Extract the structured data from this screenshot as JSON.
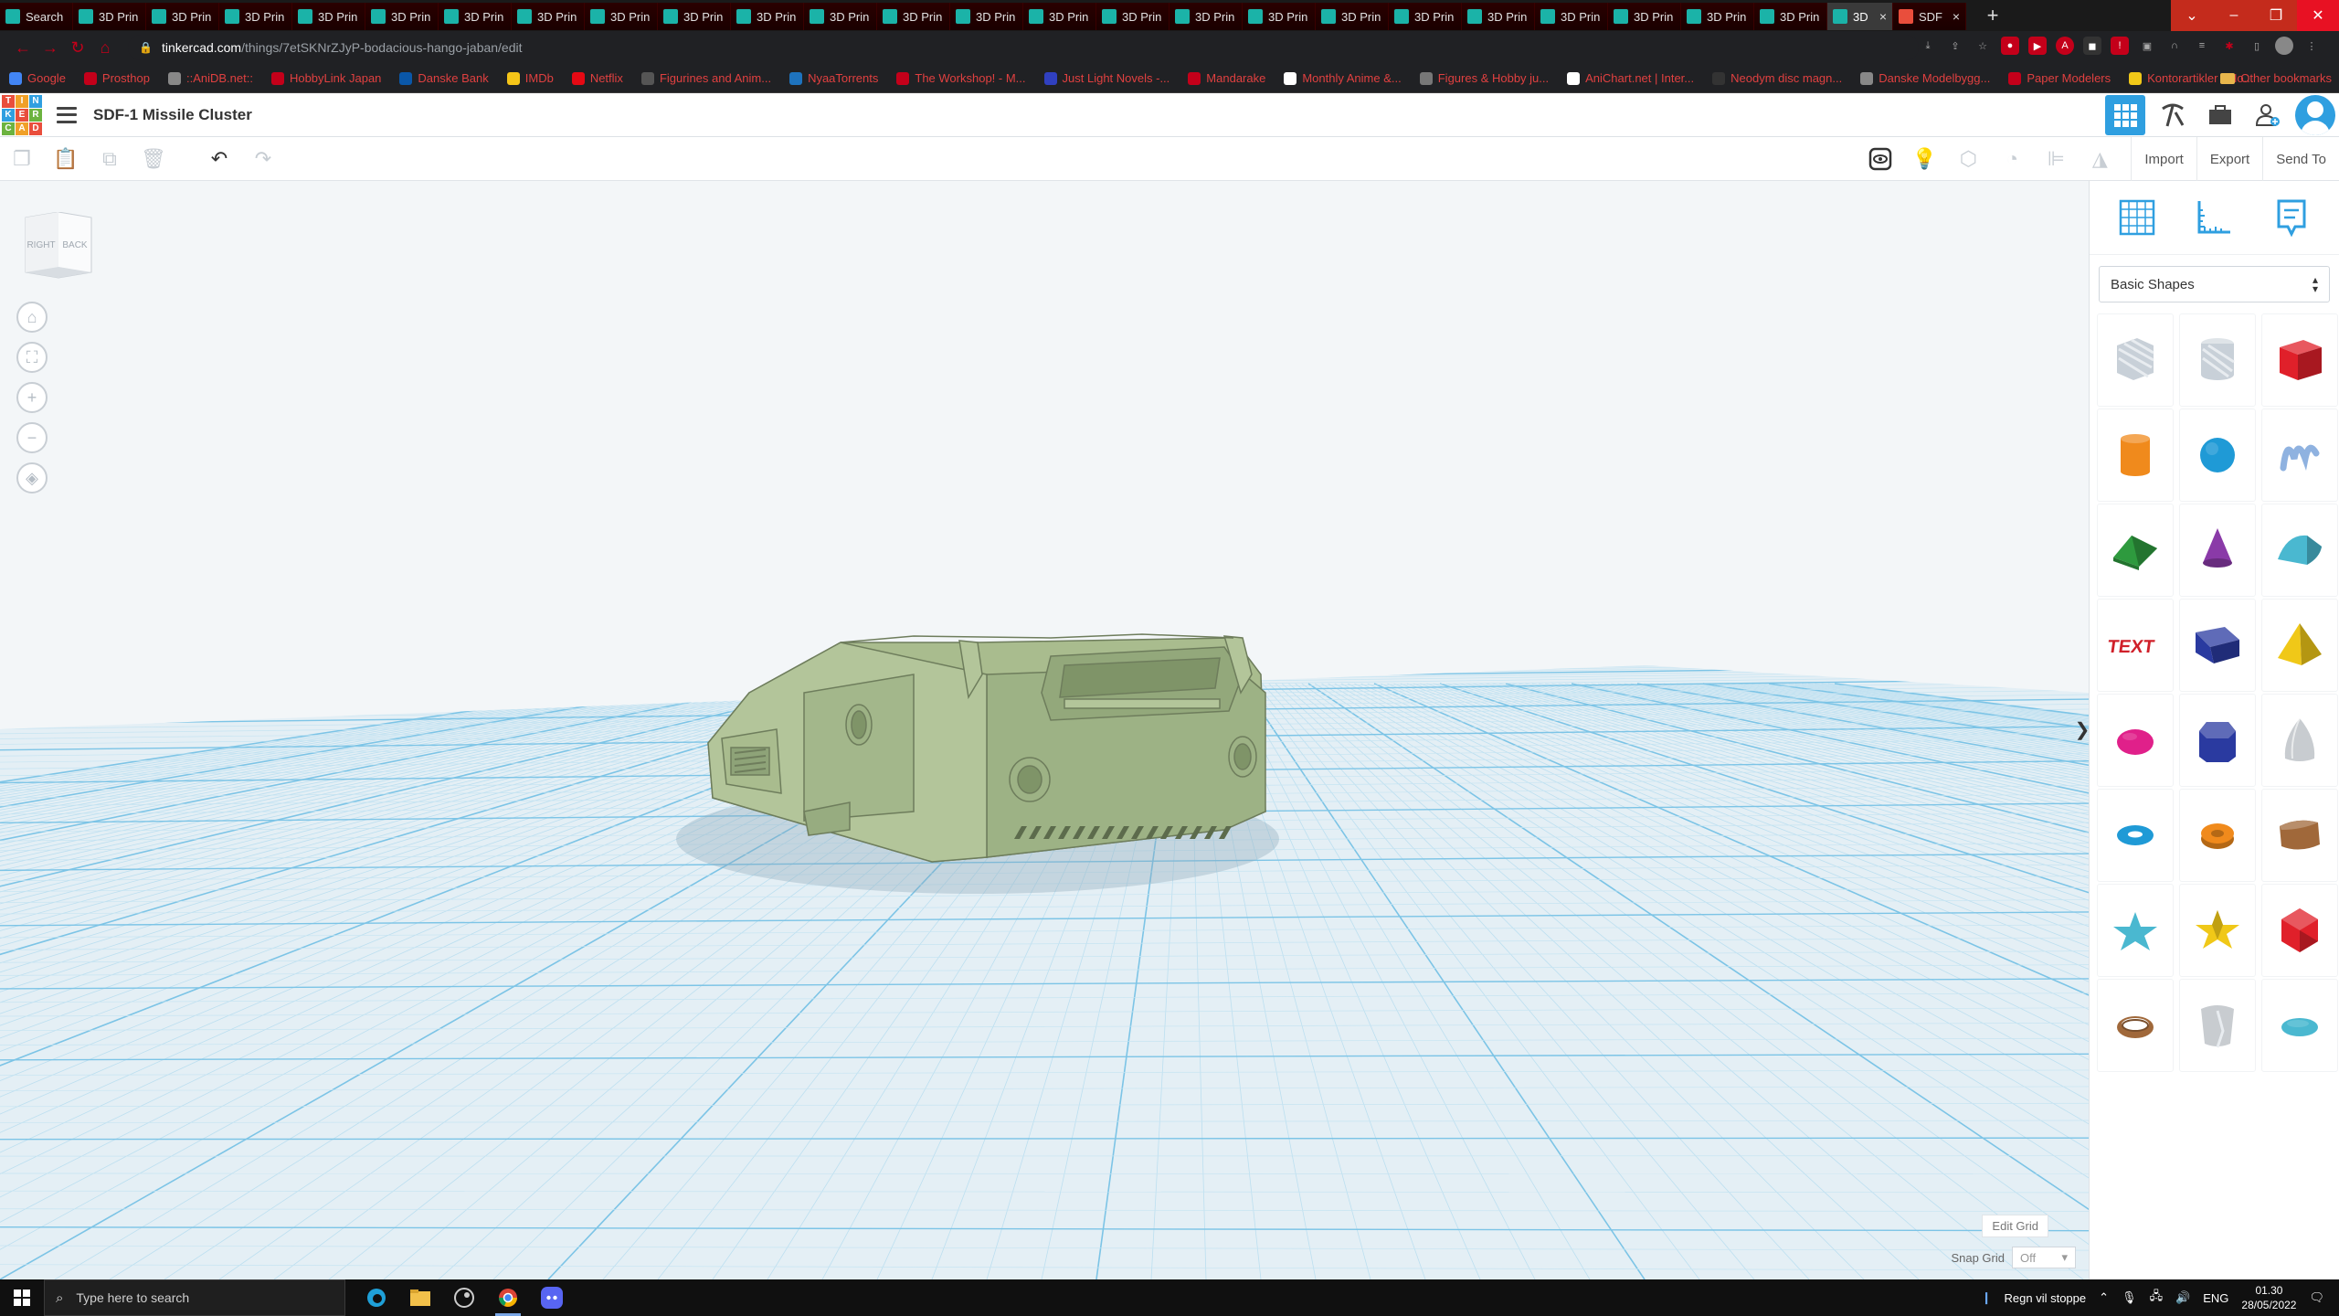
{
  "browser": {
    "tabs": [
      {
        "label": "Search",
        "icon": "tinkercad-icon"
      },
      {
        "label": "3D Prin",
        "icon": "tinkercad-icon"
      },
      {
        "label": "3D Prin",
        "icon": "tinkercad-icon"
      },
      {
        "label": "3D Prin",
        "icon": "tinkercad-icon"
      },
      {
        "label": "3D Prin",
        "icon": "tinkercad-icon"
      },
      {
        "label": "3D Prin",
        "icon": "tinkercad-icon"
      },
      {
        "label": "3D Prin",
        "icon": "tinkercad-icon"
      },
      {
        "label": "3D Prin",
        "icon": "tinkercad-icon"
      },
      {
        "label": "3D Prin",
        "icon": "tinkercad-icon"
      },
      {
        "label": "3D Prin",
        "icon": "tinkercad-icon"
      },
      {
        "label": "3D Prin",
        "icon": "tinkercad-icon"
      },
      {
        "label": "3D Prin",
        "icon": "tinkercad-icon"
      },
      {
        "label": "3D Prin",
        "icon": "tinkercad-icon"
      },
      {
        "label": "3D Prin",
        "icon": "tinkercad-icon"
      },
      {
        "label": "3D Prin",
        "icon": "tinkercad-icon"
      },
      {
        "label": "3D Prin",
        "icon": "tinkercad-icon"
      },
      {
        "label": "3D Prin",
        "icon": "tinkercad-icon"
      },
      {
        "label": "3D Prin",
        "icon": "tinkercad-icon"
      },
      {
        "label": "3D Prin",
        "icon": "tinkercad-icon"
      },
      {
        "label": "3D Prin",
        "icon": "tinkercad-icon"
      },
      {
        "label": "3D Prin",
        "icon": "tinkercad-icon"
      },
      {
        "label": "3D Prin",
        "icon": "tinkercad-icon"
      },
      {
        "label": "3D Prin",
        "icon": "tinkercad-icon"
      },
      {
        "label": "3D Prin",
        "icon": "tinkercad-icon"
      },
      {
        "label": "3D Prin",
        "icon": "tinkercad-icon"
      },
      {
        "label": "3D",
        "icon": "tinkercad-icon",
        "active": true
      },
      {
        "label": "SDF",
        "icon": "image-icon"
      }
    ],
    "new_tab": "+",
    "url_host": "tinkercad.com",
    "url_path": "/things/7etSKNrZJyP-bodacious-hango-jaban/edit",
    "bookmarks": [
      "Google",
      "Prosthop",
      "::AniDB.net::",
      "HobbyLink Japan",
      "Danske Bank",
      "IMDb",
      "Netflix",
      "Figurines and Anim...",
      "NyaaTorrents",
      "The Workshop! - M...",
      "Just Light Novels -...",
      "Mandarake",
      "Monthly Anime &...",
      "Figures & Hobby ju...",
      "AniChart.net | Inter...",
      "Neodym disc magn...",
      "Danske Modelbygg...",
      "Paper Modelers",
      "Kontorartikler - Ho..."
    ],
    "other_bookmarks": "Other bookmarks"
  },
  "tinkercad": {
    "logo_letters": [
      "T",
      "I",
      "N",
      "K",
      "E",
      "R",
      "C",
      "A",
      "D"
    ],
    "logo_colors": [
      "#e94e3c",
      "#f0a028",
      "#2f9fe0",
      "#2f9fe0",
      "#e94e3c",
      "#6cb33f",
      "#6cb33f",
      "#f0a028",
      "#e94e3c"
    ],
    "title": "SDF-1 Missile Cluster",
    "toolbar": {
      "import": "Import",
      "export": "Export",
      "send_to": "Send To"
    },
    "viewcube": {
      "right": "RIGHT",
      "back": "BACK"
    },
    "edit_grid": "Edit Grid",
    "snap_grid_label": "Snap Grid",
    "snap_grid_value": "Off",
    "panel": {
      "category": "Basic Shapes",
      "shapes": [
        {
          "name": "box-hole",
          "color": "#b9c2cc"
        },
        {
          "name": "cylinder-hole",
          "color": "#b9c2cc"
        },
        {
          "name": "box",
          "color": "#e0202a"
        },
        {
          "name": "cylinder",
          "color": "#f08a1c"
        },
        {
          "name": "sphere",
          "color": "#1f9ad6"
        },
        {
          "name": "scribble",
          "color": "#8fb2e0"
        },
        {
          "name": "roof",
          "color": "#2e9a3e"
        },
        {
          "name": "cone",
          "color": "#8a3aa8"
        },
        {
          "name": "round-roof",
          "color": "#4ab8d0"
        },
        {
          "name": "text",
          "color": "#d0202a"
        },
        {
          "name": "wedge",
          "color": "#2a3aa0"
        },
        {
          "name": "pyramid",
          "color": "#f0c818"
        },
        {
          "name": "half-sphere",
          "color": "#e0208a"
        },
        {
          "name": "polygon",
          "color": "#2a3aa0"
        },
        {
          "name": "paraboloid",
          "color": "#c8ccd0"
        },
        {
          "name": "torus",
          "color": "#1f9ad6"
        },
        {
          "name": "tube",
          "color": "#f08a1c"
        },
        {
          "name": "shape-generator",
          "color": "#a0683a"
        },
        {
          "name": "star",
          "color": "#4ab8d0"
        },
        {
          "name": "star-gold",
          "color": "#f0c818"
        },
        {
          "name": "icosahedron",
          "color": "#e0202a"
        },
        {
          "name": "ring",
          "color": "#a0683a"
        },
        {
          "name": "heart-grey",
          "color": "#c8ccd0"
        },
        {
          "name": "ellipsoid",
          "color": "#4ab8d0"
        }
      ]
    }
  },
  "taskbar": {
    "search_placeholder": "Type here to search",
    "weather": "Regn vil stoppe",
    "lang": "ENG",
    "time": "01.30",
    "date": "28/05/2022"
  }
}
